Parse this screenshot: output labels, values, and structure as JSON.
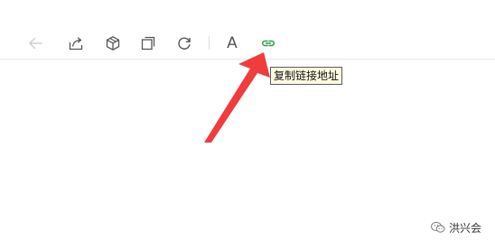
{
  "toolbar": {
    "buttons": [
      {
        "name": "back-arrow-icon",
        "enabled": false
      },
      {
        "name": "share-icon",
        "enabled": true
      },
      {
        "name": "cube-icon",
        "enabled": true
      },
      {
        "name": "copy-icon",
        "enabled": true
      },
      {
        "name": "refresh-icon",
        "enabled": true
      },
      {
        "name": "font-icon",
        "label": "A",
        "enabled": true
      },
      {
        "name": "link-icon",
        "enabled": true
      }
    ],
    "link_color": "#2f9e4b"
  },
  "tooltip": {
    "text": "复制链接地址"
  },
  "annotation": {
    "arrow_color": "#f03c3c"
  },
  "watermark": {
    "text": "洪兴会"
  }
}
